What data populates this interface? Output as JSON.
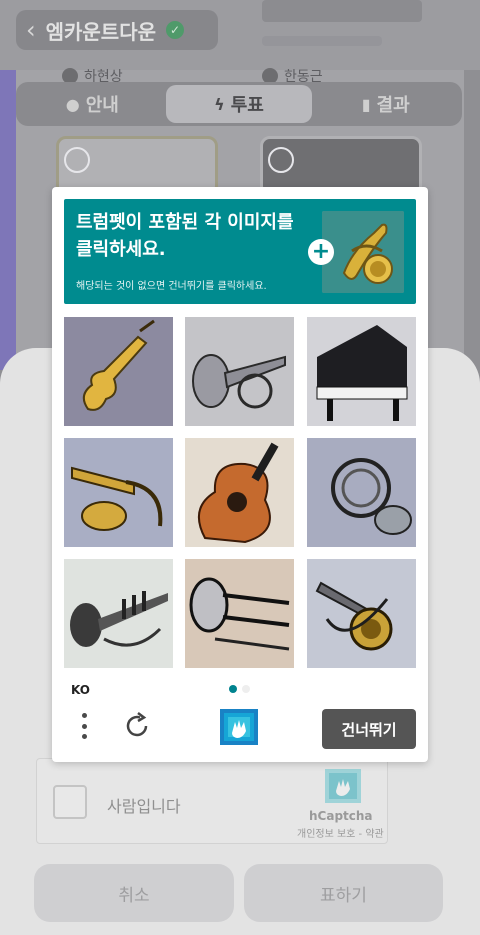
{
  "app": {
    "back_title": "엠카운트다운",
    "candidates": [
      "하현상",
      "한동근"
    ],
    "tabs": [
      {
        "label": "안내",
        "icon": "bulb-icon",
        "active": false
      },
      {
        "label": "투표",
        "icon": "lightning-icon",
        "active": true
      },
      {
        "label": "결과",
        "icon": "bar-chart-icon",
        "active": false
      }
    ]
  },
  "widget": {
    "checkbox_label": "사람입니다",
    "brand": "hCaptcha",
    "links": "개인정보 보호 - 약관"
  },
  "footer": {
    "cancel_label": "취소",
    "vote_label": "표하기"
  },
  "challenge": {
    "prompt_title": "트럼펫이 포함된 각 이미지를 클릭하세요.",
    "prompt_sub": "해당되는 것이 없으면 건너뛰기를 클릭하세요.",
    "example_image": "trumpet-example",
    "tiles": [
      {
        "subject": "violin"
      },
      {
        "subject": "brass-trumpet"
      },
      {
        "subject": "grand-piano"
      },
      {
        "subject": "gold-trumpet"
      },
      {
        "subject": "acoustic-guitar"
      },
      {
        "subject": "brass-horn"
      },
      {
        "subject": "trumpet-sketch"
      },
      {
        "subject": "trombone"
      },
      {
        "subject": "trumpet-gold-bell"
      }
    ],
    "language": "KO",
    "page_indicator": {
      "current": 1,
      "total": 2
    },
    "skip_label": "건너뛰기",
    "colors": {
      "accent": "#008b8f",
      "skip_button": "#555555"
    }
  }
}
